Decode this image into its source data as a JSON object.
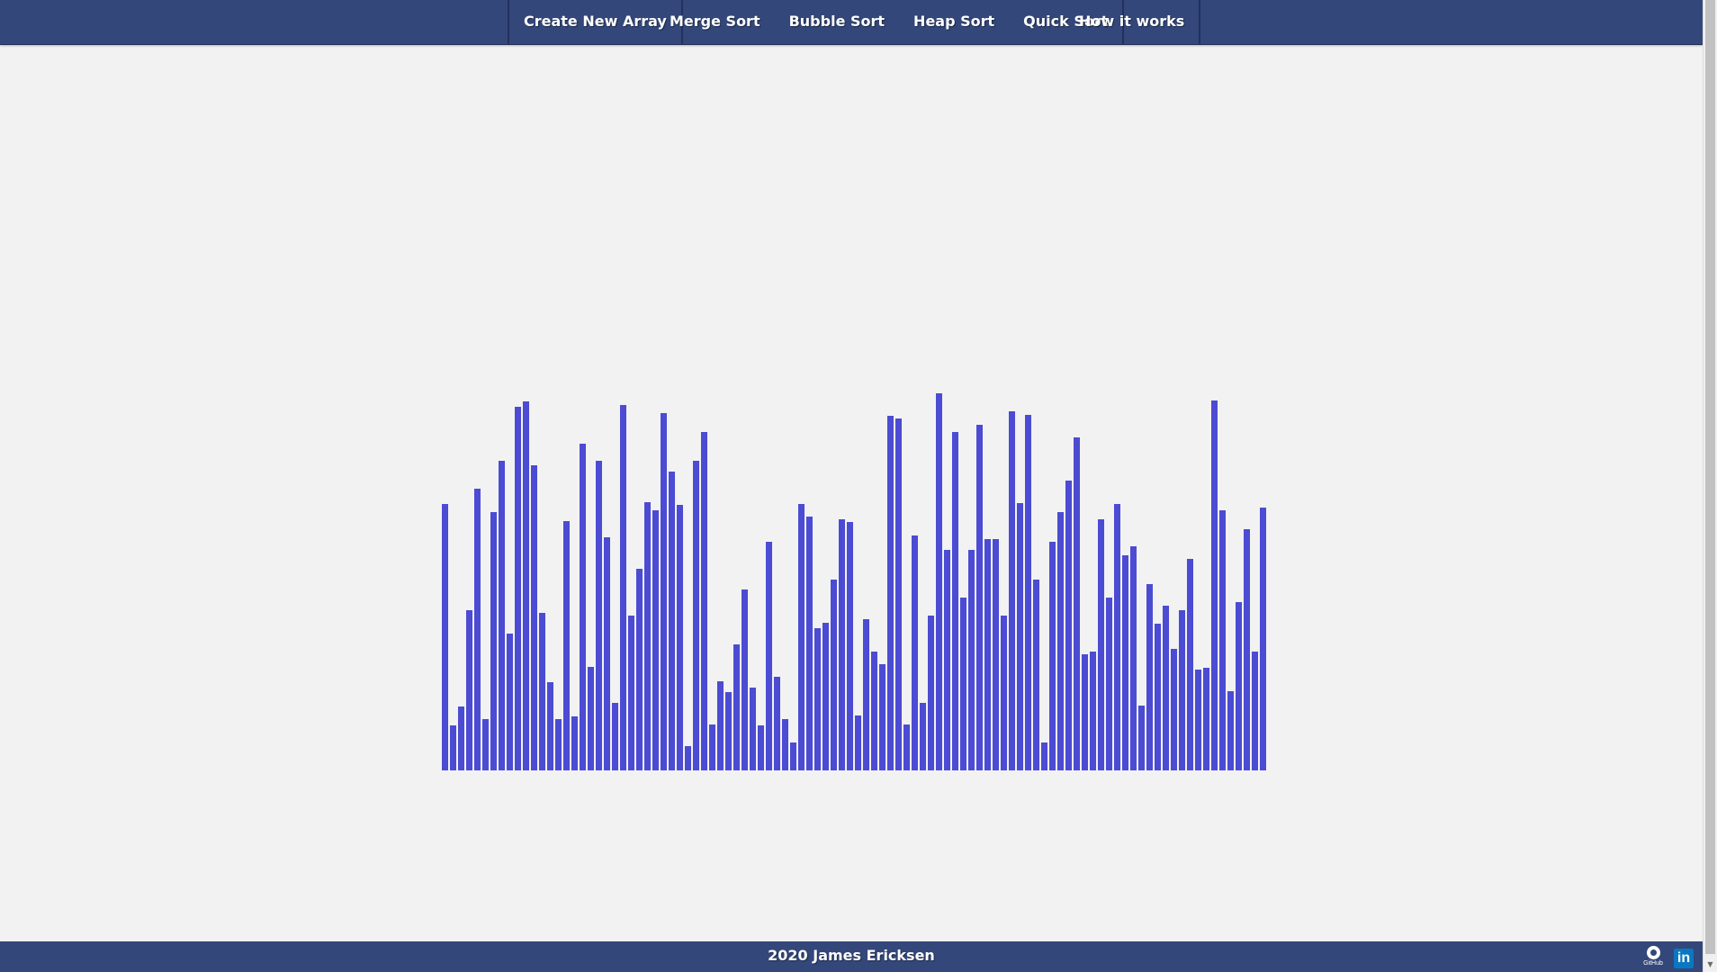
{
  "nav": {
    "create_label": "Create New Array",
    "merge_label": "Merge Sort",
    "bubble_label": "Bubble Sort",
    "heap_label": "Heap Sort",
    "quick_label": "Quick Sort",
    "how_label": "How it works"
  },
  "array": {
    "color": "#4c4bd3",
    "max_value": 400,
    "values": [
      285,
      48,
      68,
      171,
      301,
      55,
      276,
      331,
      146,
      388,
      394,
      326,
      168,
      94,
      55,
      266,
      58,
      349,
      111,
      331,
      249,
      72,
      390,
      165,
      215,
      287,
      278,
      382,
      319,
      284,
      26,
      331,
      362,
      49,
      95,
      84,
      135,
      193,
      88,
      48,
      244,
      100,
      55,
      30,
      285,
      271,
      152,
      158,
      204,
      268,
      265,
      59,
      162,
      127,
      113,
      379,
      376,
      49,
      251,
      72,
      165,
      403,
      236,
      362,
      185,
      236,
      369,
      247,
      247,
      165,
      384,
      286,
      380,
      204,
      30,
      244,
      276,
      310,
      356,
      124,
      127,
      268,
      185,
      285,
      230,
      239,
      69,
      199,
      157,
      176,
      130,
      171,
      226,
      108,
      110,
      395,
      278,
      85,
      180,
      258,
      127,
      281
    ]
  },
  "footer": {
    "text": "2020 James Ericksen",
    "github_label": "GitHub",
    "linkedin_label": "in"
  }
}
